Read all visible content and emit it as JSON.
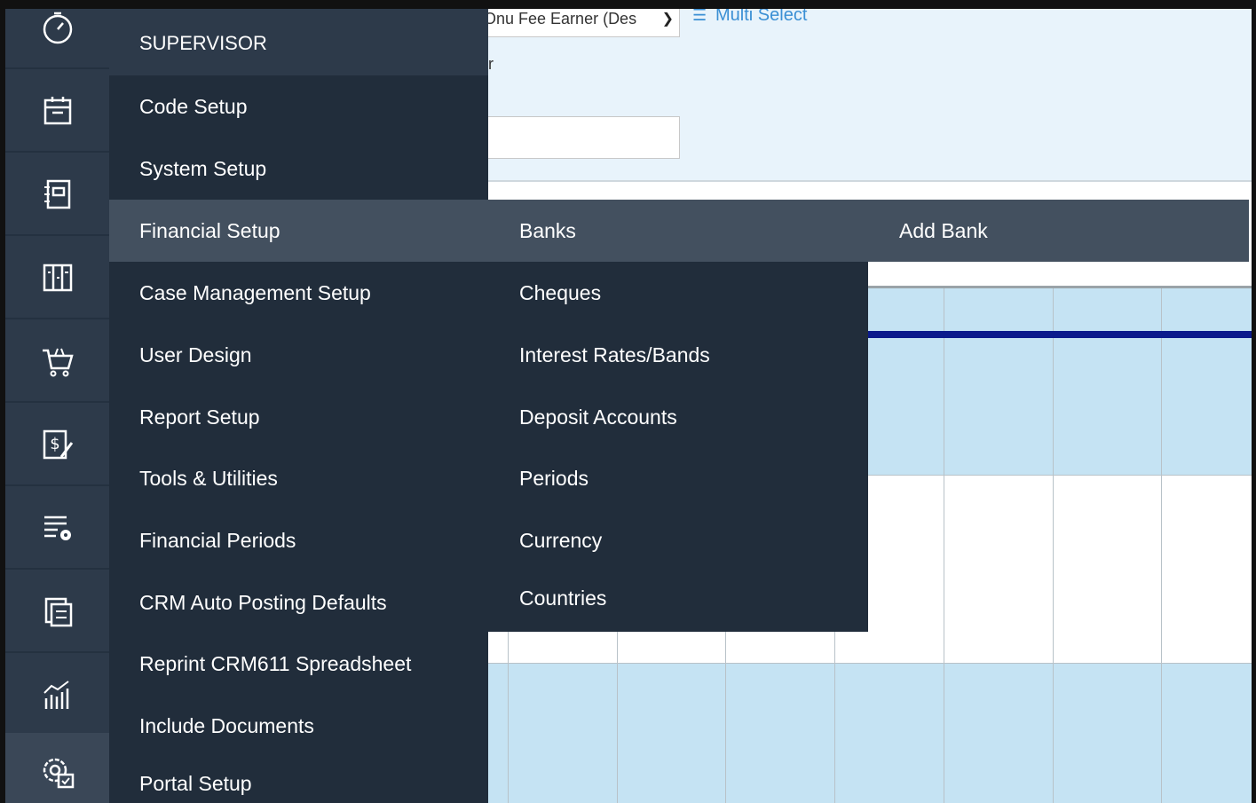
{
  "filter": {
    "fee_earner_select": "Onu Fee Earner (Des",
    "multi_select_label": "Multi Select",
    "partial_label": "r"
  },
  "supervisor_menu": {
    "header": "SUPERVISOR",
    "items": [
      {
        "label": "Code Setup"
      },
      {
        "label": "System Setup"
      },
      {
        "label": "Financial Setup",
        "active": true
      },
      {
        "label": "Case Management Setup"
      },
      {
        "label": "User Design"
      },
      {
        "label": "Report Setup"
      },
      {
        "label": "Tools & Utilities"
      },
      {
        "label": "Financial Periods"
      },
      {
        "label": "CRM Auto Posting Defaults"
      },
      {
        "label": "Reprint CRM611 Spreadsheet"
      },
      {
        "label": "Include Documents"
      },
      {
        "label": "Portal Setup"
      }
    ]
  },
  "financial_submenu": {
    "items": [
      {
        "label": "Banks",
        "active": true
      },
      {
        "label": "Cheques"
      },
      {
        "label": "Interest Rates/Bands"
      },
      {
        "label": "Deposit Accounts"
      },
      {
        "label": "Periods"
      },
      {
        "label": "Currency"
      },
      {
        "label": "Countries"
      }
    ]
  },
  "banks_submenu": {
    "items": [
      {
        "label": "Add Bank"
      }
    ]
  },
  "rail_icons": [
    "clock-icon",
    "calendar-icon",
    "ledger-icon",
    "books-icon",
    "cart-icon",
    "invoice-icon",
    "list-settings-icon",
    "documents-icon",
    "reports-chart-icon",
    "settings-gear-icon"
  ],
  "colors": {
    "rail": "#2d3a4a",
    "menu": "#212d3b",
    "menu_active": "#43505f",
    "grid_blue": "#c5e3f3",
    "link": "#3a8fd4"
  }
}
